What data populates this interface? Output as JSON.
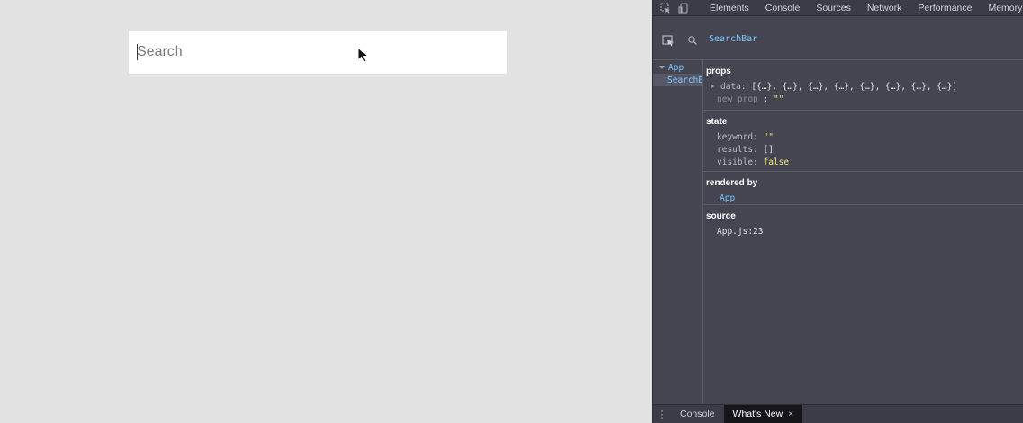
{
  "page": {
    "search": {
      "placeholder": "Search",
      "value": ""
    }
  },
  "devtools": {
    "tabs": [
      {
        "label": "Elements"
      },
      {
        "label": "Console"
      },
      {
        "label": "Sources"
      },
      {
        "label": "Network"
      },
      {
        "label": "Performance"
      },
      {
        "label": "Memory"
      }
    ],
    "selected_component": "SearchBar",
    "tree": [
      {
        "label": "App",
        "expanded": true
      },
      {
        "label": "SearchBar",
        "selected": true
      }
    ],
    "props": {
      "title": "props",
      "data_key": "data",
      "data_value": "[{…}, {…}, {…}, {…}, {…}, {…}, {…}, {…}]",
      "new_prop_key": "new prop",
      "new_prop_value": "\"\""
    },
    "state": {
      "title": "state",
      "keyword_key": "keyword",
      "keyword_value": "\"\"",
      "results_key": "results",
      "results_value": "[]",
      "visible_key": "visible",
      "visible_value": "false"
    },
    "rendered_by": {
      "title": "rendered by",
      "value": "App"
    },
    "source": {
      "title": "source",
      "value": "App.js:23"
    },
    "drawer": {
      "menu_icon": "vertical-dots-icon",
      "tabs": [
        {
          "label": "Console",
          "active": false
        },
        {
          "label": "What's New",
          "active": true
        }
      ],
      "close_glyph": "×"
    }
  },
  "colors": {
    "page_bg": "#e2e2e2",
    "devtools_bg": "#444551",
    "component_name": "#7cc5ff",
    "string_value": "#f6e87a"
  }
}
